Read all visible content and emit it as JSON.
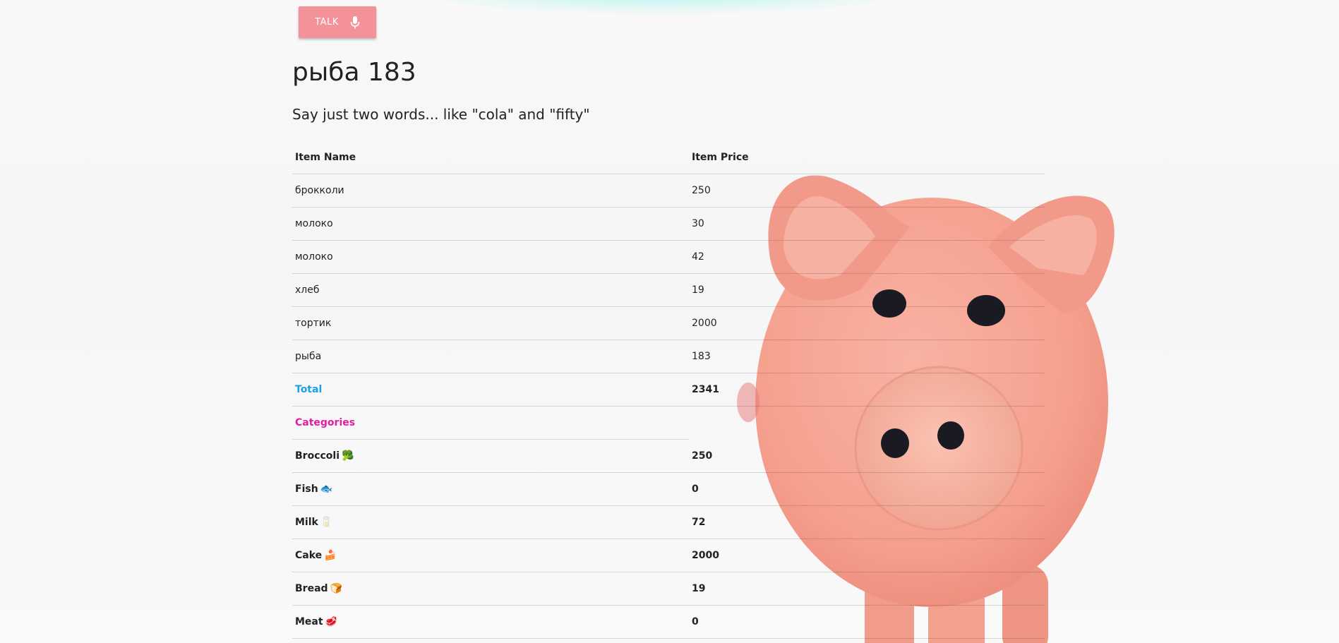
{
  "talk_button": {
    "label": "TALK",
    "icon": "microphone-icon"
  },
  "title": "рыба 183",
  "instructions": "Say just two words... like \"cola\" and \"fifty\"",
  "table": {
    "headers": {
      "name": "Item Name",
      "price": "Item Price"
    },
    "items": [
      {
        "name": "брокколи",
        "price": "250"
      },
      {
        "name": "молоко",
        "price": "30"
      },
      {
        "name": "молоко",
        "price": "42"
      },
      {
        "name": "хлеб",
        "price": "19"
      },
      {
        "name": "тортик",
        "price": "2000"
      },
      {
        "name": "рыба",
        "price": "183"
      }
    ],
    "total": {
      "label": "Total",
      "value": "2341"
    },
    "categories_label": "Categories",
    "categories": [
      {
        "name": "Broccoli",
        "emoji": "🥦",
        "value": "250"
      },
      {
        "name": "Fish",
        "emoji": "🐟",
        "value": "0"
      },
      {
        "name": "Milk",
        "emoji": "🥛",
        "value": "72"
      },
      {
        "name": "Cake",
        "emoji": "🍰",
        "value": "2000"
      },
      {
        "name": "Bread",
        "emoji": "🍞",
        "value": "19"
      },
      {
        "name": "Meat",
        "emoji": "🥩",
        "value": "0"
      }
    ]
  },
  "colors": {
    "talk_button": "#f4929a",
    "total_label": "#1aa0e6",
    "categories_label": "#e01ea6",
    "pig": "#f7a594"
  }
}
